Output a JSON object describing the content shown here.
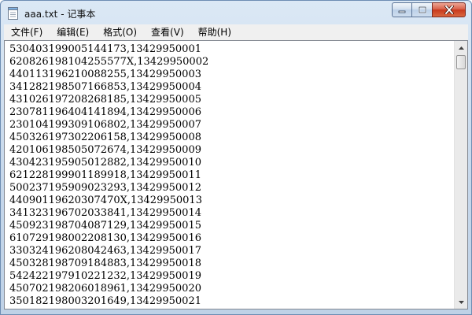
{
  "window": {
    "title": "aaa.txt - 记事本",
    "buttons": {
      "minimize_icon": "minimize-icon",
      "maximize_icon": "maximize-icon",
      "close_icon": "close-icon"
    }
  },
  "menu": [
    {
      "label": "文件(F)"
    },
    {
      "label": "编辑(E)"
    },
    {
      "label": "格式(O)"
    },
    {
      "label": "查看(V)"
    },
    {
      "label": "帮助(H)"
    }
  ],
  "lines": [
    "530403199005144173,13429950001",
    "620826198104255577X,13429950002",
    "440113196210088255,13429950003",
    "341282198507166853,13429950004",
    "431026197208268185,13429950005",
    "230781196404141894,13429950006",
    "230104199309106802,13429950007",
    "450326197302206158,13429950008",
    "420106198505072674,13429950009",
    "430423195905012882,13429950010",
    "621228199901189918,13429950011",
    "500237195909023293,13429950012",
    "44090119620307470X,13429950013",
    "341323196702033841,13429950014",
    "450923198704087129,13429950015",
    "610729198002208130,13429950016",
    "330324196208042463,13429950017",
    "450328198709184883,13429950018",
    "542422197910221232,13429950019",
    "450702198206018961,13429950020",
    "350182198003201649,13429950021"
  ],
  "colors": {
    "titlebar": "#c6d7ea",
    "close": "#c8391d",
    "menubar": "#f0f0f0"
  }
}
